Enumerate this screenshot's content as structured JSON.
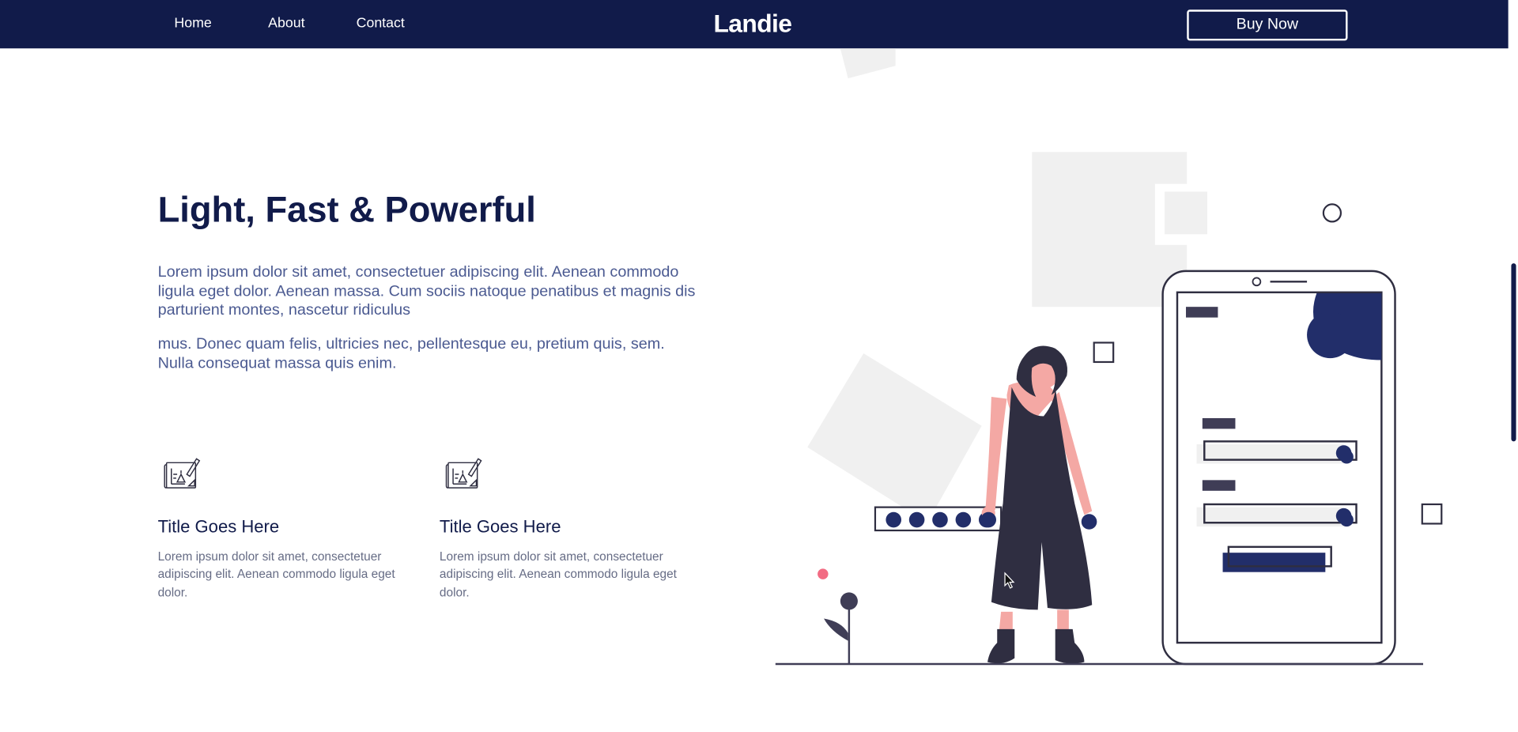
{
  "nav": {
    "links": [
      {
        "label": "Home"
      },
      {
        "label": "About"
      },
      {
        "label": "Contact"
      }
    ],
    "brand": "Landie",
    "cta_label": "Buy Now"
  },
  "hero": {
    "title": "Light, Fast & Powerful",
    "paragraphs": [
      "Lorem ipsum dolor sit amet, consectetuer adipiscing elit. Aenean commodo ligula eget dolor. Aenean massa. Cum sociis natoque penatibus et magnis dis parturient montes, nascetur ridiculus",
      "mus. Donec quam felis, ultricies nec, pellentesque eu, pretium quis, sem. Nulla consequat massa quis enim."
    ]
  },
  "features": [
    {
      "icon": "blueprint-icon",
      "title": "Title Goes Here",
      "text": "Lorem ipsum dolor sit amet, consectetuer adipiscing elit. Aenean commodo ligula eget dolor."
    },
    {
      "icon": "blueprint-icon",
      "title": "Title Goes Here",
      "text": "Lorem ipsum dolor sit amet, consectetuer adipiscing elit. Aenean commodo ligula eget dolor."
    }
  ],
  "colors": {
    "navy": "#111b4a",
    "paragraph": "#4b5a91",
    "muted": "#666c85",
    "skin": "#f4a8a4",
    "accent_pink": "#f26b83",
    "illustration_dark": "#2f2e41",
    "illustration_blue": "#222e6a",
    "light_gray": "#f0f0f0"
  }
}
